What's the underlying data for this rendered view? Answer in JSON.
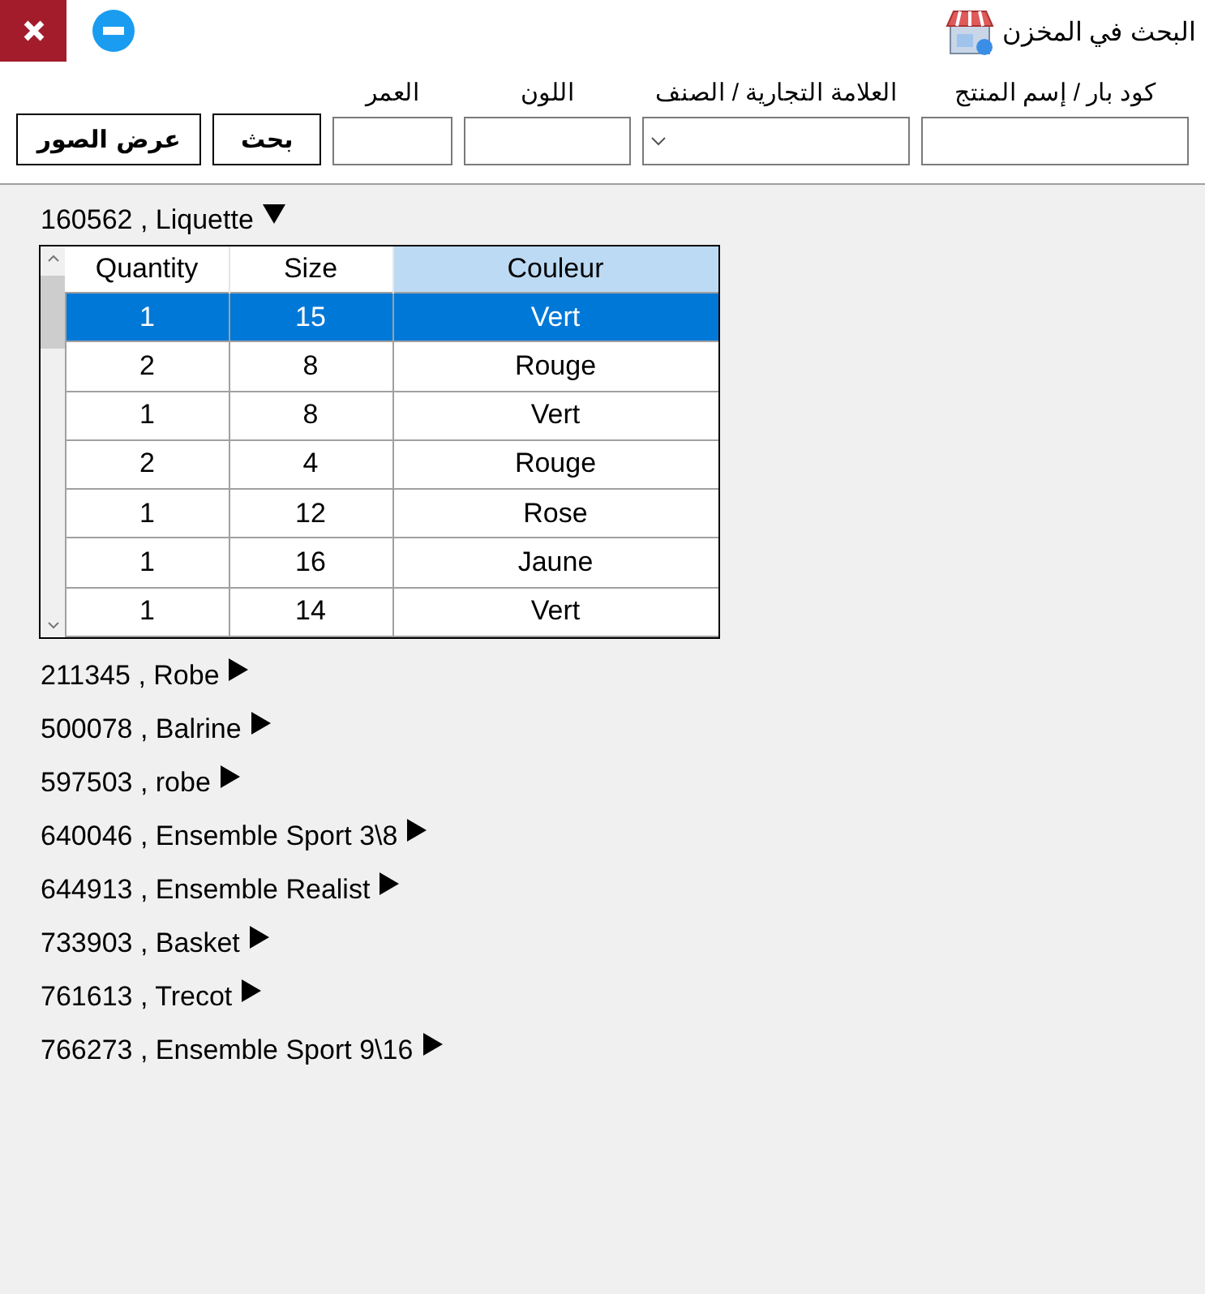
{
  "window": {
    "title": "البحث في المخزن"
  },
  "toolbar": {
    "fields": [
      {
        "label": "كود بار / إسم المنتج",
        "kind": "text"
      },
      {
        "label": "العلامة التجارية / الصنف",
        "kind": "dropdown"
      },
      {
        "label": "اللون",
        "kind": "text"
      },
      {
        "label": "العمر",
        "kind": "text"
      }
    ],
    "buttons": [
      "بحث",
      "عرض الصور"
    ]
  },
  "products": [
    {
      "title": "160562 , Liquette",
      "expanded": true,
      "table": {
        "columns": [
          {
            "label": "Quantity",
            "selected": false
          },
          {
            "label": "Size",
            "selected": false
          },
          {
            "label": "Couleur",
            "selected": true
          }
        ],
        "rows": [
          {
            "cells": [
              "1",
              "15",
              "Vert"
            ],
            "selected": true
          },
          {
            "cells": [
              "2",
              "8",
              "Rouge"
            ],
            "selected": false
          },
          {
            "cells": [
              "1",
              "8",
              "Vert"
            ],
            "selected": false
          },
          {
            "cells": [
              "2",
              "4",
              "Rouge"
            ],
            "selected": false
          },
          {
            "cells": [
              "1",
              "12",
              "Rose"
            ],
            "selected": false
          },
          {
            "cells": [
              "1",
              "16",
              "Jaune"
            ],
            "selected": false
          },
          {
            "cells": [
              "1",
              "14",
              "Vert"
            ],
            "selected": false
          }
        ]
      }
    },
    {
      "title": "211345 , Robe",
      "expanded": false
    },
    {
      "title": "500078 , Balrine",
      "expanded": false
    },
    {
      "title": "597503 , robe",
      "expanded": false
    },
    {
      "title": "640046 , Ensemble Sport 3\\8",
      "expanded": false
    },
    {
      "title": "644913 , Ensemble Realist",
      "expanded": false
    },
    {
      "title": "733903 , Basket",
      "expanded": false
    },
    {
      "title": "761613 , Trecot",
      "expanded": false
    },
    {
      "title": "766273 , Ensemble Sport 9\\16",
      "expanded": false
    }
  ]
}
